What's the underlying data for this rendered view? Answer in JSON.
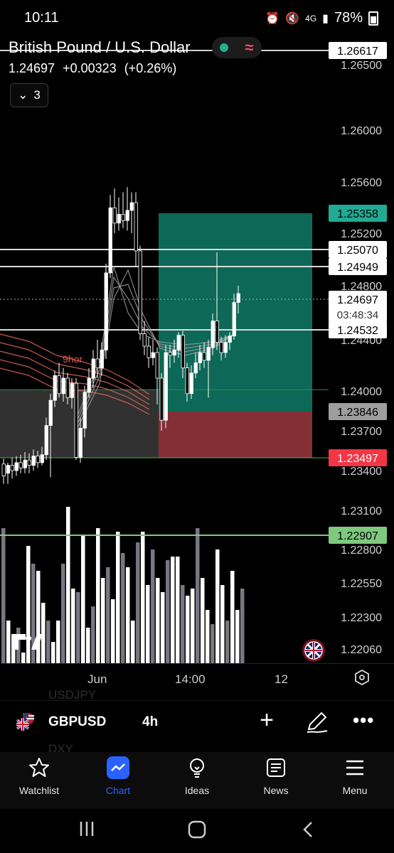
{
  "status_bar": {
    "time": "10:11",
    "network": "4G",
    "battery": "78%"
  },
  "header": {
    "title": "British Pound / U.S. Dollar",
    "last_price": "1.24697",
    "change": "+0.00323",
    "change_pct": "(+0.26%)",
    "indicator_count": "3",
    "market_status_icons": [
      "market-open-dot-icon",
      "realtime-wave-icon"
    ]
  },
  "chart": {
    "watermark_label": "9hor",
    "price_axis": [
      "1.26500",
      "1.26000",
      "1.25600",
      "1.25200",
      "1.24800",
      "1.24400",
      "1.24000",
      "1.23700",
      "1.23400",
      "1.23100",
      "1.22800",
      "1.22550",
      "1.22300",
      "1.22060"
    ],
    "price_tags": [
      {
        "label": "1.26617",
        "color": "#ffffff",
        "text": "#000000"
      },
      {
        "label": "1.25358",
        "color": "#22ab94",
        "text": "#000000"
      },
      {
        "label": "1.25070",
        "color": "#ffffff",
        "text": "#000000"
      },
      {
        "label": "1.24949",
        "color": "#ffffff",
        "text": "#000000"
      },
      {
        "label": "1.24697",
        "color": "#ffffff",
        "text": "#000000",
        "countdown": "03:48:34"
      },
      {
        "label": "1.24532",
        "color": "#ffffff",
        "text": "#000000"
      },
      {
        "label": "1.23846",
        "color": "#9e9e9e",
        "text": "#000000"
      },
      {
        "label": "1.23497",
        "color": "#f23645",
        "text": "#ffffff"
      },
      {
        "label": "1.22907",
        "color": "#7fc97f",
        "text": "#000000"
      }
    ],
    "position_tool": {
      "target": 1.25358,
      "entry": 1.23846,
      "stop": 1.23497,
      "profit_color": "#0f7a66",
      "loss_color": "#8a3138"
    },
    "time_axis": [
      "Jun",
      "14:00",
      "12"
    ]
  },
  "symbol_bar": {
    "ghost_above": "USDJPY",
    "ghost_below": "DXY",
    "symbol": "GBPUSD",
    "interval": "4h"
  },
  "bottom_nav": [
    {
      "label": "Watchlist",
      "icon": "star-icon",
      "active": false
    },
    {
      "label": "Chart",
      "icon": "chart-icon",
      "active": true
    },
    {
      "label": "Ideas",
      "icon": "lightbulb-icon",
      "active": false
    },
    {
      "label": "News",
      "icon": "news-icon",
      "active": false
    },
    {
      "label": "Menu",
      "icon": "menu-icon",
      "active": false
    }
  ],
  "colors": {
    "accent": "#2962ff",
    "up": "#ffffff",
    "down": "#ffffff"
  }
}
